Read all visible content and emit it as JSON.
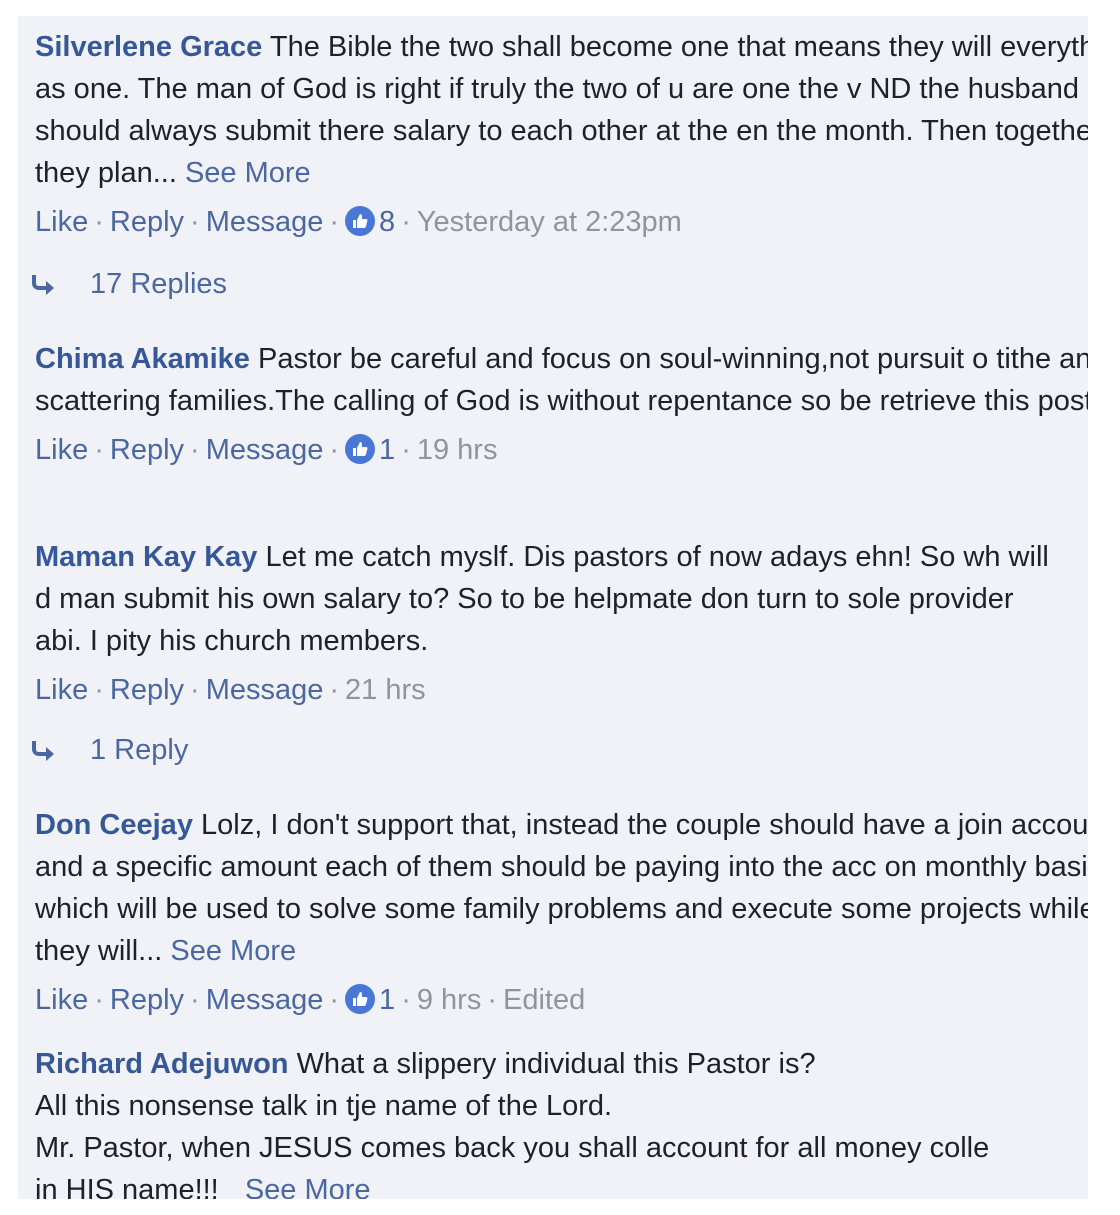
{
  "actions": {
    "like": "Like",
    "reply": "Reply",
    "message": "Message",
    "see_more": "See More",
    "separator": "·"
  },
  "comments": [
    {
      "author": "Silverlene Grace",
      "text": "The Bible the two shall become one that means they will everything as one. The man of God is right if truly the two of u are one the v ND the husband should always submit there salary to each other at the en the month. Then together they plan...",
      "likes": "8",
      "time": "Yesterday at 2:23pm",
      "replies": "17 Replies"
    },
    {
      "author": "Chima Akamike",
      "text": "Pastor be careful and focus on soul-winning,not pursuit o tithe and scattering families.The calling of God is without repentance so be retrieve this post.",
      "likes": "1",
      "time": "19 hrs"
    },
    {
      "author": "Maman Kay Kay",
      "text": "Let me catch myslf. Dis pastors of now adays ehn! So wh will d man submit his own salary to? So to be helpmate don turn to sole provider abi. I pity his church members.",
      "time": "21 hrs",
      "replies": "1 Reply"
    },
    {
      "author": "Don Ceejay",
      "text": "Lolz, I don't support that, instead the couple should have a join account and a specific amount each of them should be paying into the acc on monthly basis, which will be used to solve some family problems and execute some projects while they will...",
      "likes": "1",
      "time": "9 hrs",
      "edited": "Edited"
    },
    {
      "author": "Richard Adejuwon",
      "text_lines": [
        "What a slippery individual this Pastor is?",
        "All this nonsense talk in tje name of the Lord.",
        "Mr. Pastor, when JESUS comes back you shall account for all money colle",
        "in HIS name!!!"
      ]
    }
  ],
  "colors": {
    "panel_background": "#f0f2f7",
    "author": "#365899",
    "link": "#4b67a1",
    "text": "#1d2129",
    "muted": "#90949c",
    "like_badge": "#4877d6"
  },
  "icons": {
    "like_badge": "thumbs-up-icon",
    "reply_arrow": "reply-arrow-icon"
  }
}
